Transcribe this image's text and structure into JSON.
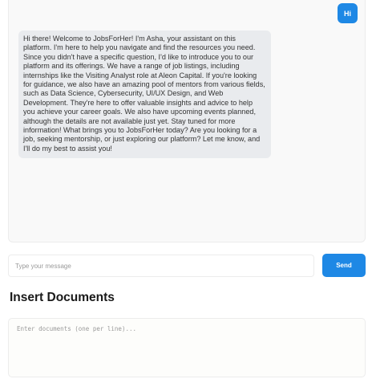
{
  "chat": {
    "messages": [
      {
        "role": "user",
        "text": "Hi"
      },
      {
        "role": "assistant",
        "text": "Hi there! Welcome to JobsForHer! I'm Asha, your assistant on this platform. I'm here to help you navigate and find the resources you need. Since you didn't have a specific question, I'd like to introduce you to our platform and its offerings. We have a range of job listings, including internships like the Visiting Analyst role at Aleon Capital. If you're looking for guidance, we also have an amazing pool of mentors from various fields, such as Data Science, Cybersecurity, UI/UX Design, and Web Development. They're here to offer valuable insights and advice to help you achieve your career goals. We also have upcoming events planned, although the details are not available just yet. Stay tuned for more information! What brings you to JobsForHer today? Are you looking for a job, seeking mentorship, or just exploring our platform? Let me know, and I'll do my best to assist you!"
      }
    ]
  },
  "input": {
    "placeholder": "Type your message",
    "value": "",
    "send_label": "Send"
  },
  "documents": {
    "title": "Insert Documents",
    "placeholder": "Enter documents (one per line)...",
    "value": ""
  },
  "colors": {
    "accent": "#1e88e5",
    "assistant_bubble": "#e9ebee",
    "panel_bg": "#f9f9f9"
  }
}
